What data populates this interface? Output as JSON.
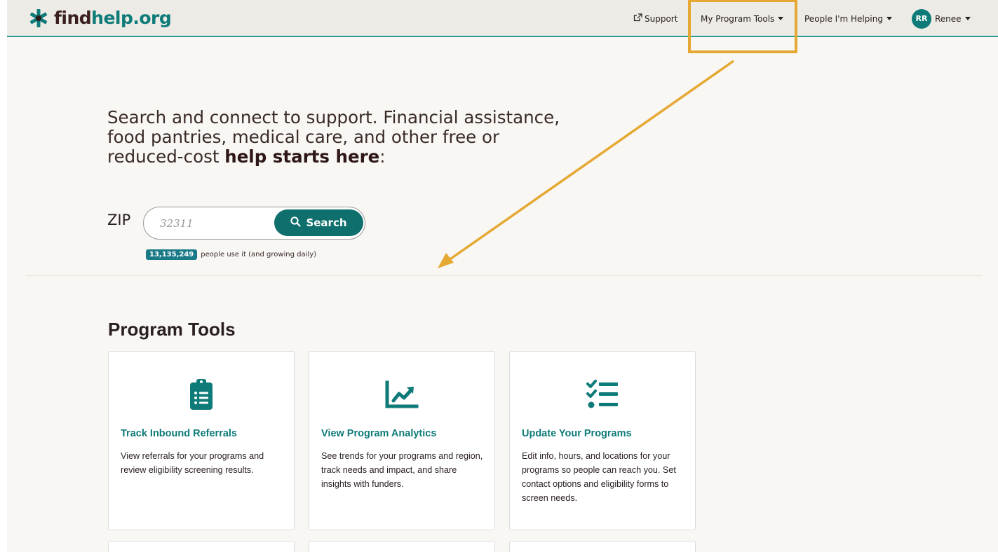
{
  "header": {
    "logo": {
      "find": "find",
      "help": "help.org",
      "icon": "asterisk-icon"
    },
    "nav": {
      "support": "Support",
      "program_tools": "My Program Tools",
      "people_helping": "People I'm Helping",
      "avatar_initials": "RR",
      "user_name": "Renee"
    }
  },
  "hero": {
    "line1": "Search and connect to support. Financial assistance,",
    "line2": "food pantries, medical care, and other free or",
    "line3_prefix": "reduced-cost ",
    "line3_bold": "help starts here",
    "line3_suffix": ":"
  },
  "search": {
    "zip_label": "ZIP",
    "placeholder": "32311",
    "button_label": "Search",
    "count": "13,135,249",
    "count_suffix": "people use it (and growing daily)"
  },
  "program_tools": {
    "title": "Program Tools",
    "cards": [
      {
        "icon": "clipboard-list-icon",
        "title": "Track Inbound Referrals",
        "description": "View referrals for your programs and review eligibility screening results."
      },
      {
        "icon": "chart-line-icon",
        "title": "View Program Analytics",
        "description": "See trends for your programs and region, track needs and impact, and share insights with funders."
      },
      {
        "icon": "checklist-icon",
        "title": "Update Your Programs",
        "description": "Edit info, hours, and locations for your programs so people can reach you. Set contact options and eligibility forms to screen needs."
      }
    ]
  },
  "colors": {
    "brand_teal": "#0f7b79",
    "highlight": "#e5a832",
    "header_bg": "#edebe6"
  }
}
